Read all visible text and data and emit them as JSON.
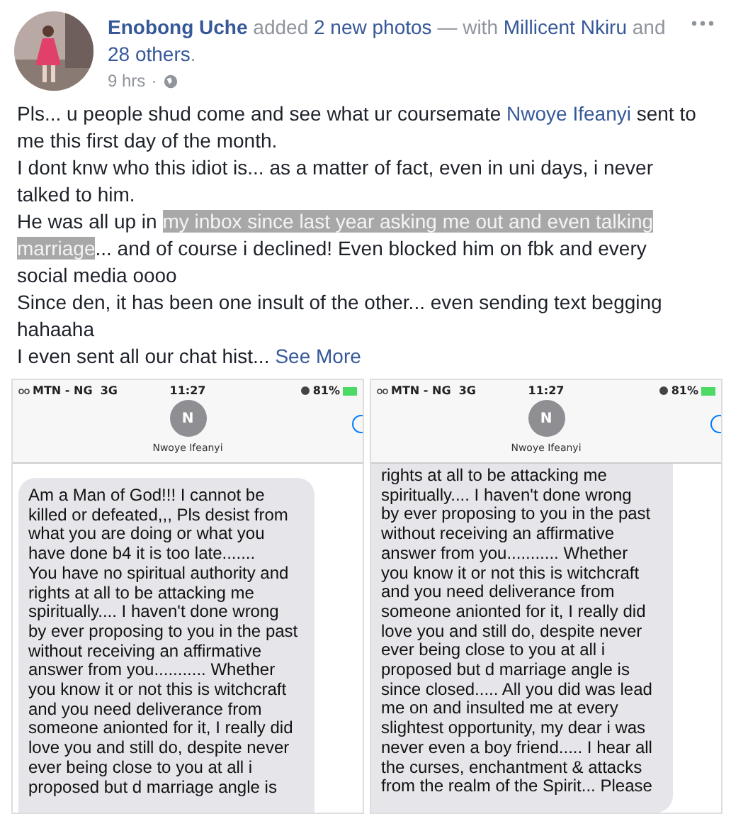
{
  "post": {
    "author": "Enobong Uche",
    "action": "added",
    "photos_link": "2 new photos",
    "with_text": "— with",
    "tagged": "Millicent Nkiru",
    "and_text": "and",
    "others_link": "28 others",
    "period": ".",
    "time": "9 hrs",
    "separator": "·",
    "paragraphs": [
      {
        "segments": [
          {
            "text": "Pls... u people shud come and see what ur coursemate ",
            "highlighted": false,
            "kind": "text"
          },
          {
            "text": "Nwoye Ifeanyi",
            "kind": "link"
          },
          {
            "text": " sent to me this first day of the month.",
            "highlighted": false,
            "kind": "text"
          }
        ]
      },
      {
        "segments": [
          {
            "text": "I dont knw who this idiot is... as a matter of fact, even in uni days, i never talked to him.",
            "highlighted": false,
            "kind": "text"
          }
        ]
      },
      {
        "segments": [
          {
            "text": "He was all up in ",
            "highlighted": false,
            "kind": "text"
          },
          {
            "text": "my inbox since last year asking me out and even talking marriage",
            "highlighted": true,
            "kind": "text"
          },
          {
            "text": "... and of course i declined! Even blocked him on fbk and every social media oooo",
            "highlighted": false,
            "kind": "text"
          }
        ]
      },
      {
        "segments": [
          {
            "text": "Since den, it has been one insult of the other... even sending text begging hahaaha",
            "highlighted": false,
            "kind": "text"
          }
        ]
      },
      {
        "segments": [
          {
            "text": "I even sent all our chat hist...",
            "highlighted": false,
            "kind": "text"
          },
          {
            "text": "See More",
            "kind": "more"
          }
        ]
      }
    ]
  },
  "photos": [
    {
      "carrier": "MTN - NG  3G",
      "time": "11:27",
      "battery": "81%",
      "initial": "N",
      "contact": "Nwoye Ifeanyi",
      "cut_top": false,
      "lines": [
        "Am a Man of God!!! I cannot be",
        "killed or defeated,,, Pls desist from",
        "what you are doing or what you",
        "have done b4 it is too late.......",
        "You have no spiritual authority and",
        "rights at all to be attacking me",
        "spiritually.... I haven't done wrong",
        "by ever proposing to you in the past",
        "without receiving an affirmative",
        "answer from you........... Whether",
        "you know it or not this is witchcraft",
        "and you need deliverance from",
        "someone anionted for it, I really did",
        "love you and still do, despite never",
        "ever being close to you at all i",
        "proposed but d marriage angle is"
      ]
    },
    {
      "carrier": "MTN - NG  3G",
      "time": "11:27",
      "battery": "81%",
      "initial": "N",
      "contact": "Nwoye Ifeanyi",
      "cut_top": true,
      "lines": [
        "rights at all to be attacking me",
        "spiritually.... I haven't done wrong",
        "by ever proposing to you in the past",
        "without receiving an affirmative",
        "answer from you........... Whether",
        "you know it or not this is witchcraft",
        "and you need deliverance from",
        "someone anionted for it, I really did",
        "love you and still do, despite never",
        "ever being close to you at all i",
        "proposed but d marriage angle is",
        "since closed..... All you did was lead",
        "me on and insulted me at every",
        "slightest opportunity, my dear i was",
        "never even a boy friend..... I hear all",
        "the curses, enchantment & attacks",
        "from the realm of the Spirit... Please"
      ]
    }
  ]
}
